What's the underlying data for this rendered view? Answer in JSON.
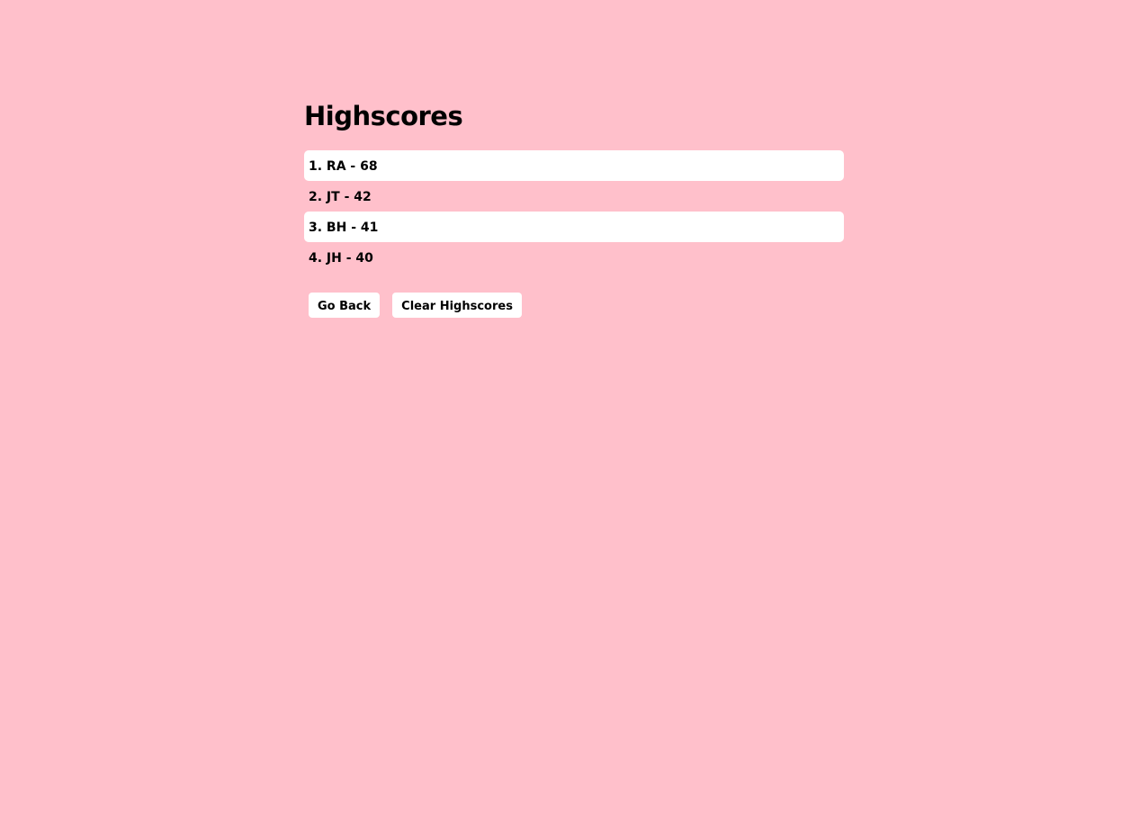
{
  "page": {
    "title": "Highscores",
    "background_color": "#ffc0cb"
  },
  "scores": [
    {
      "text": "1. RA - 68"
    },
    {
      "text": "2. JT - 42"
    },
    {
      "text": "3. BH - 41"
    },
    {
      "text": "4. JH - 40"
    }
  ],
  "buttons": {
    "go_back_label": "Go Back",
    "clear_label": "Clear Highscores"
  }
}
